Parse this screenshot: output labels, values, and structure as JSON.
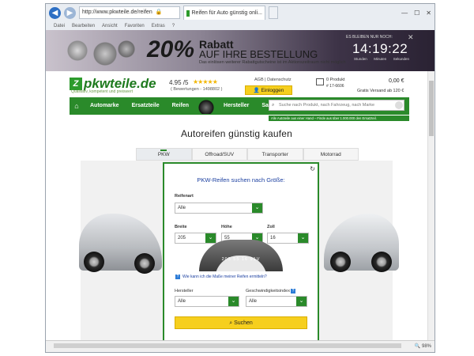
{
  "browser": {
    "url": "http://www.pkwteile.de/reifen",
    "tab_title": "Reifen für Auto günstig onli...",
    "menu": [
      "Datei",
      "Bearbeiten",
      "Ansicht",
      "Favoriten",
      "Extras",
      "?"
    ],
    "zoom": "98%"
  },
  "banner": {
    "percent": "20%",
    "headline": "Rabatt",
    "subline": "AUF IHRE BESTELLUNG",
    "note": "Das einlösen weiterer Rabattgutscheine ist im Aktionszeitraum nicht möglich",
    "countdown_label": "ES BLEIBEN NUR NOCH:",
    "time": "14:19:22",
    "units": [
      "Stunden",
      "Minuten",
      "Sekunden"
    ]
  },
  "header": {
    "logo": "pkwteile.de",
    "slogan": "Qualitativ, kompetent und preiswert",
    "rating": "4.95 /5",
    "stars": "★★★★★",
    "reviews": "( Bewertungen - 1498802 )",
    "agb": "AGB | Datenschutz",
    "login": "Einloggen",
    "cart_count": "0 Produkt",
    "cart_phone": "# 17-6606",
    "cart_total": "0,00 €",
    "shipping": "Gratis Versand ab 120 €"
  },
  "nav": {
    "items": [
      "Automarke",
      "Ersatzteile",
      "Reifen",
      "Hersteller",
      "Sales"
    ],
    "search_placeholder": "Suche nach Produkt, nach Fahrzeug, nach Marke",
    "promo": "Alle Autoteile aus einer Hand – Finde aus über 1.000.000 den Ersatzteil."
  },
  "page": {
    "title": "Autoreifen günstig kaufen",
    "tabs": [
      "PKW",
      "Offroad/SUV",
      "Transporter",
      "Motorrad"
    ]
  },
  "form": {
    "title": "PKW-Reifen suchen nach Größe:",
    "reifenart_label": "Reifenart",
    "reifenart_value": "Alle",
    "breite_label": "Breite",
    "breite_value": "205",
    "hoehe_label": "Höhe",
    "hoehe_value": "55",
    "zoll_label": "Zoll",
    "zoll_value": "16",
    "tyre_code": "205 55 16 91V",
    "hint": "Wie kann ich die Maße meiner Reifen ermitteln?",
    "hersteller_label": "Hersteller",
    "hersteller_value": "Alle",
    "speed_label": "Geschwindigkeitsindex",
    "speed_value": "Alle",
    "search_button": "Suchen"
  }
}
